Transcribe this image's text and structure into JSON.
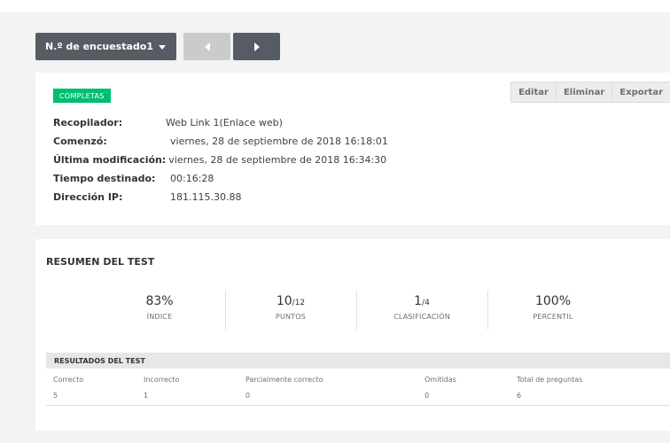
{
  "nav": {
    "respondent_label": "N.º de encuestado1"
  },
  "actions": {
    "edit": "Editar",
    "delete": "Eliminar",
    "export": "Exportar"
  },
  "status": "COMPLETAS",
  "meta": {
    "collector_label": "Recopilador:",
    "collector_value": "Web Link 1(Enlace web)",
    "started_label": "Comenzó:",
    "started_value": "viernes, 28 de septiembre de 2018 16:18:01",
    "modified_label": "Última modificación:",
    "modified_value": "viernes, 28 de septiembre de 2018 16:34:30",
    "time_label": "Tiempo destinado:",
    "time_value": "00:16:28",
    "ip_label": "Dirección IP:",
    "ip_value": "181.115.30.88"
  },
  "summary": {
    "title": "RESUMEN DEL TEST",
    "stats": [
      {
        "value": "83%",
        "of": "",
        "label": "ÍNDICE"
      },
      {
        "value": "10",
        "of": "/12",
        "label": "PUNTOS"
      },
      {
        "value": "1",
        "of": "/4",
        "label": "CLASIFICACIÓN"
      },
      {
        "value": "100%",
        "of": "",
        "label": "PERCENTIL"
      }
    ]
  },
  "results": {
    "title": "RESULTADOS DEL TEST",
    "columns": [
      "Correcto",
      "Incorrecto",
      "Parcialmente correcto",
      "Omitidas",
      "Total de preguntas"
    ],
    "values": [
      "5",
      "1",
      "0",
      "0",
      "6"
    ]
  },
  "colors": {
    "badge": "#00bf6f",
    "dark_button": "#555c63",
    "disabled_button": "#c9cbcd"
  }
}
